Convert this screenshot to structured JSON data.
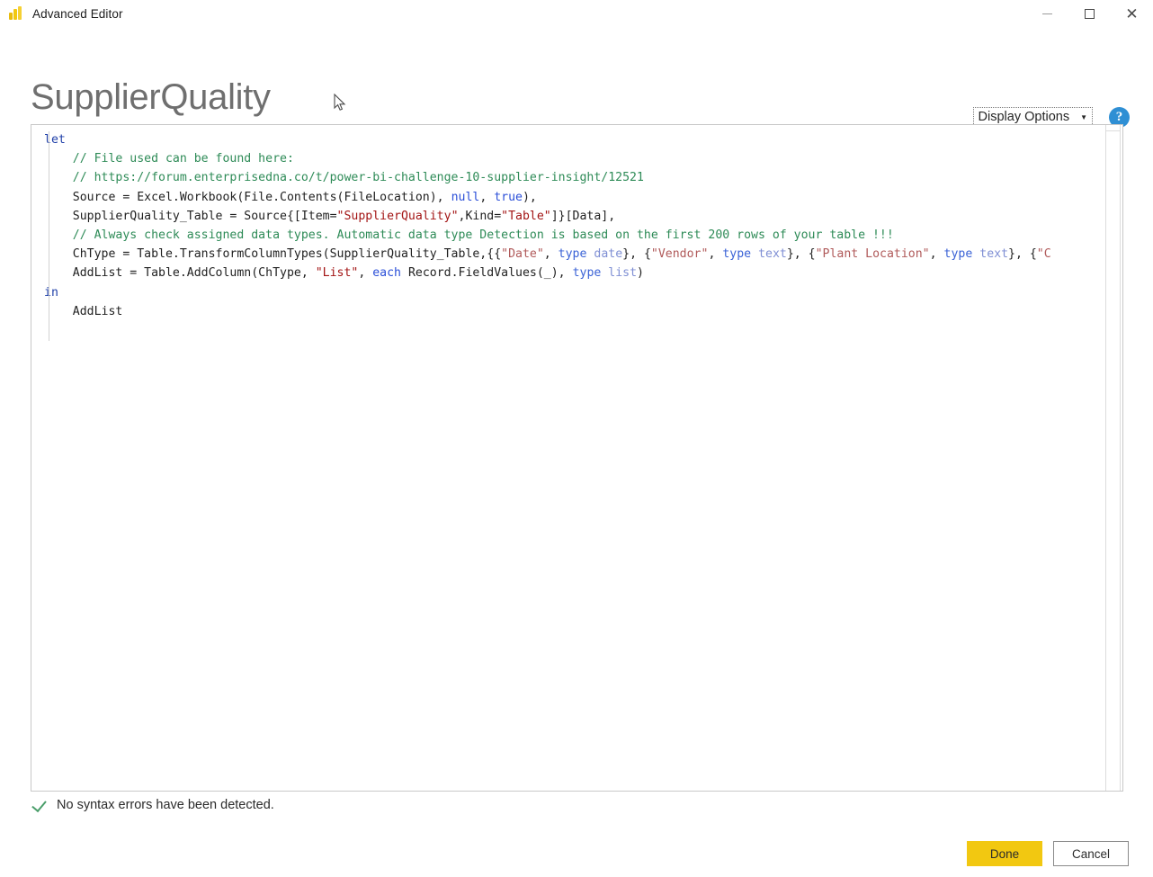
{
  "window": {
    "title": "Advanced Editor",
    "app_icon": "power-bi-icon",
    "controls": {
      "minimize": "minimize-icon",
      "maximize": "maximize-icon",
      "close": "close-icon"
    }
  },
  "header": {
    "query_name": "SupplierQuality",
    "display_options_label": "Display Options",
    "display_options_caret": "▼",
    "help_label": "?"
  },
  "editor": {
    "lines": [
      {
        "tokens": [
          {
            "t": "let",
            "c": "kw"
          }
        ]
      },
      {
        "tokens": [
          {
            "t": "    // File used can be found here:",
            "c": "cmt"
          }
        ]
      },
      {
        "tokens": [
          {
            "t": "    // https://forum.enterprisedna.co/t/power-bi-challenge-10-supplier-insight/12521",
            "c": "cmt"
          }
        ]
      },
      {
        "tokens": [
          {
            "t": "    Source = Excel.Workbook(File.Contents(FileLocation), ",
            "c": "plain"
          },
          {
            "t": "null",
            "c": "kw2"
          },
          {
            "t": ", ",
            "c": "plain"
          },
          {
            "t": "true",
            "c": "kw2"
          },
          {
            "t": "),",
            "c": "plain"
          }
        ]
      },
      {
        "tokens": [
          {
            "t": "    SupplierQuality_Table = Source{[Item=",
            "c": "plain"
          },
          {
            "t": "\"SupplierQuality\"",
            "c": "str"
          },
          {
            "t": ",Kind=",
            "c": "plain"
          },
          {
            "t": "\"Table\"",
            "c": "str"
          },
          {
            "t": "]}[Data],",
            "c": "plain"
          }
        ]
      },
      {
        "tokens": [
          {
            "t": "    // Always check assigned data types. Automatic data type Detection is based on the first 200 rows of your table !!!",
            "c": "cmt"
          }
        ]
      },
      {
        "tokens": [
          {
            "t": "    ChType = Table.TransformColumnTypes(SupplierQuality_Table,{{",
            "c": "plain"
          },
          {
            "t": "\"Date\"",
            "c": "str2"
          },
          {
            "t": ", ",
            "c": "plain"
          },
          {
            "t": "type",
            "c": "type-kw"
          },
          {
            "t": " ",
            "c": "plain"
          },
          {
            "t": "date",
            "c": "type-nm"
          },
          {
            "t": "}, {",
            "c": "plain"
          },
          {
            "t": "\"Vendor\"",
            "c": "str2"
          },
          {
            "t": ", ",
            "c": "plain"
          },
          {
            "t": "type",
            "c": "type-kw"
          },
          {
            "t": " ",
            "c": "plain"
          },
          {
            "t": "text",
            "c": "type-nm"
          },
          {
            "t": "}, {",
            "c": "plain"
          },
          {
            "t": "\"Plant Location\"",
            "c": "str2"
          },
          {
            "t": ", ",
            "c": "plain"
          },
          {
            "t": "type",
            "c": "type-kw"
          },
          {
            "t": " ",
            "c": "plain"
          },
          {
            "t": "text",
            "c": "type-nm"
          },
          {
            "t": "}, {",
            "c": "plain"
          },
          {
            "t": "\"C",
            "c": "str2"
          }
        ]
      },
      {
        "tokens": [
          {
            "t": "    AddList = Table.AddColumn(ChType, ",
            "c": "plain"
          },
          {
            "t": "\"List\"",
            "c": "str"
          },
          {
            "t": ", ",
            "c": "plain"
          },
          {
            "t": "each",
            "c": "kw2"
          },
          {
            "t": " Record.FieldValues(_), ",
            "c": "plain"
          },
          {
            "t": "type",
            "c": "type-kw"
          },
          {
            "t": " ",
            "c": "plain"
          },
          {
            "t": "list",
            "c": "type-nm"
          },
          {
            "t": ")",
            "c": "plain"
          }
        ]
      },
      {
        "tokens": [
          {
            "t": "in",
            "c": "kw"
          }
        ]
      },
      {
        "tokens": [
          {
            "t": "    AddList",
            "c": "plain"
          }
        ]
      }
    ]
  },
  "status": {
    "message": "No syntax errors have been detected.",
    "icon": "checkmark-icon",
    "icon_color": "#4a9e6a"
  },
  "footer": {
    "done_label": "Done",
    "cancel_label": "Cancel",
    "done_color": "#f2c811"
  }
}
